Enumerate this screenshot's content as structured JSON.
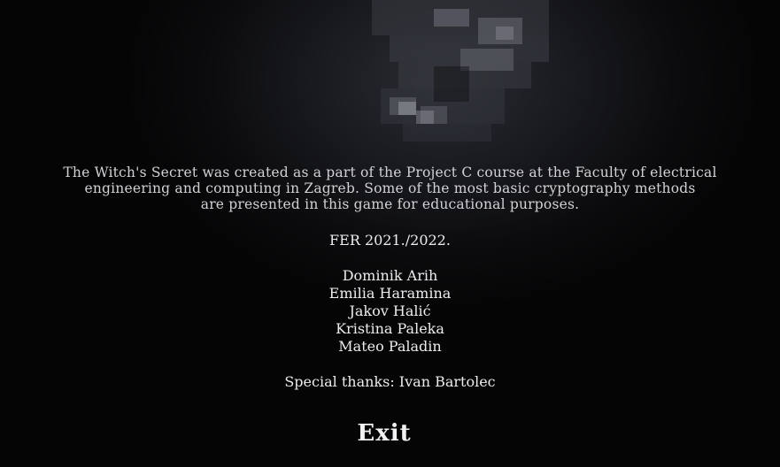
{
  "credits": {
    "intro_lines": [
      "The Witch's Secret was created as a part of the Project C course at the Faculty of electrical",
      "engineering and computing in Zagreb. Some of the most basic cryptography methods",
      "are presented in this game for educational purposes."
    ],
    "year": "FER 2021./2022.",
    "authors": [
      "Dominik Arih",
      "Emilia Haramina",
      "Jakov Halić",
      "Kristina Paleka",
      "Mateo Paladin"
    ],
    "special_thanks": "Special thanks: Ivan Bartolec"
  },
  "menu": {
    "exit_label": "Exit"
  }
}
